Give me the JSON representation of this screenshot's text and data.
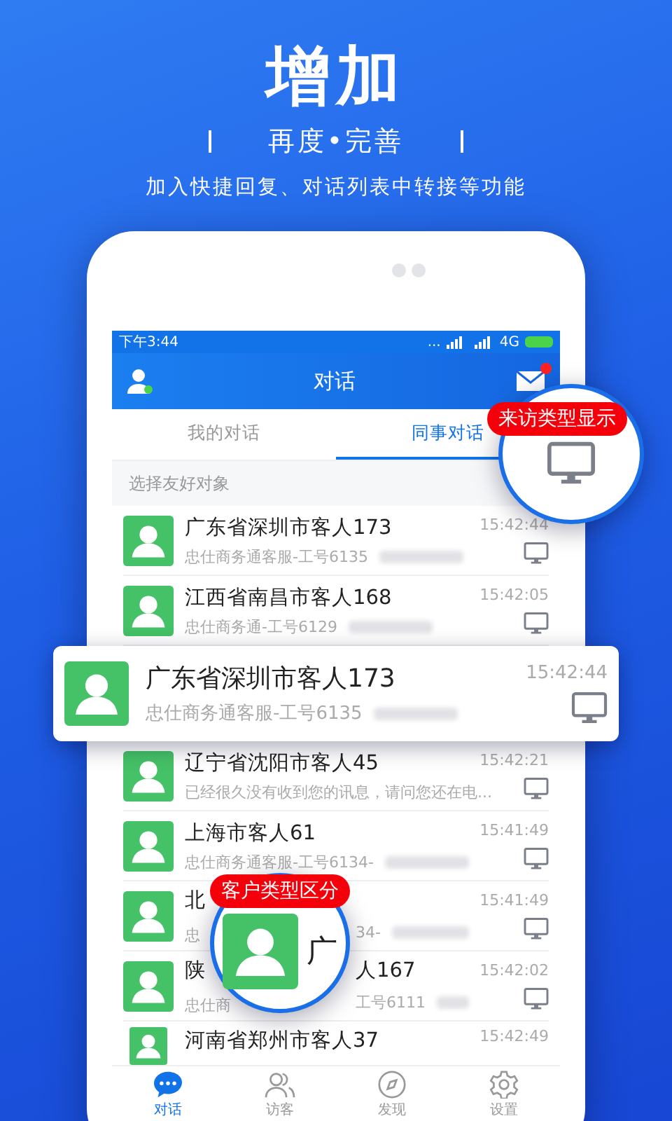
{
  "promo": {
    "title": "增加",
    "subtitle": "再度•完善",
    "description": "加入快捷回复、对话列表中转接等功能"
  },
  "status_bar": {
    "time": "下午3:44",
    "dots": "...",
    "network": "4G"
  },
  "header": {
    "title": "对话",
    "unread": true
  },
  "tabs": [
    {
      "label": "我的对话",
      "selected": false
    },
    {
      "label": "同事对话",
      "selected": true
    }
  ],
  "filter": {
    "placeholder": "选择友好对象"
  },
  "rows": [
    {
      "kind": "row",
      "name": [
        "广东省深圳市客人173"
      ],
      "subtitle": [
        "忠仕商务通客服-工号6135"
      ],
      "time": "15:42:44",
      "redacted": true
    },
    {
      "kind": "row",
      "name": [
        "江西省南昌市客人168"
      ],
      "subtitle": [
        "忠仕商务通-工号6129"
      ],
      "time": "15:42:05",
      "redacted": true
    },
    {
      "kind": "popup",
      "name": [
        "广东省深圳市客人173"
      ],
      "subtitle": [
        "忠仕商务通客服-工号6135"
      ],
      "time": "15:42:44",
      "redacted": true
    },
    {
      "kind": "row",
      "name": [
        "辽宁省沈阳市客人45"
      ],
      "subtitle": [
        "已经很久没有收到您的讯息，请问您还在电..."
      ],
      "time": "15:42:21",
      "redacted": false
    },
    {
      "kind": "row",
      "name": [
        "上海市客人61"
      ],
      "subtitle": [
        "忠仕商务通客服-工号6134-"
      ],
      "time": "15:41:49",
      "redacted": true
    },
    {
      "kind": "row",
      "name": [
        "北"
      ],
      "subtitle": [
        "忠",
        "34-"
      ],
      "time": "15:41:49",
      "redacted": true
    },
    {
      "kind": "row",
      "name": [
        "陕",
        "人167"
      ],
      "subtitle": [
        "忠仕商",
        "工号6111"
      ],
      "time": "15:42:02",
      "redacted": true
    },
    {
      "kind": "clipped",
      "name": [
        "河南省郑州市客人37"
      ],
      "subtitle": [],
      "time": "15:42:49",
      "redacted": false
    }
  ],
  "callouts": [
    {
      "kind": "visitor",
      "label": "来访类型显示"
    },
    {
      "kind": "customer",
      "label": "客户类型区分",
      "glyph": "广"
    }
  ],
  "nav": [
    {
      "label": "对话",
      "selected": true
    },
    {
      "label": "访客",
      "selected": false
    },
    {
      "label": "发现",
      "selected": false
    },
    {
      "label": "设置",
      "selected": false
    }
  ]
}
